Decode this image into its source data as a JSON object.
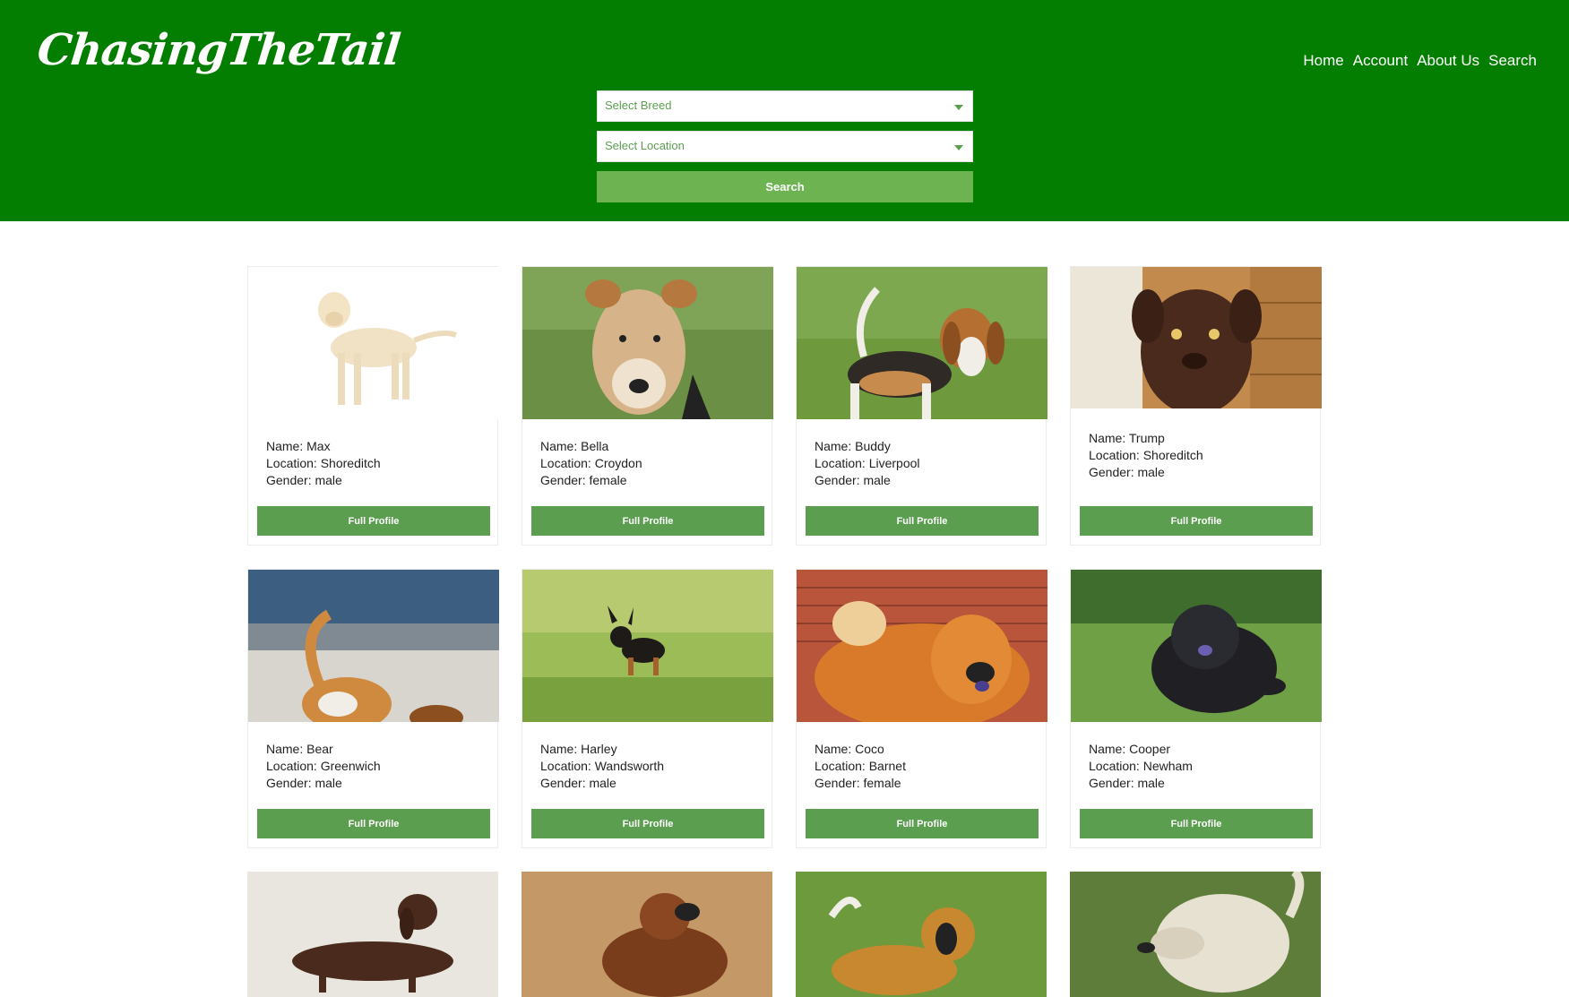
{
  "brand": {
    "logo": "ChasingTheTail"
  },
  "nav": [
    "Home",
    "Account",
    "About Us",
    "Search"
  ],
  "search": {
    "breed_placeholder": "Select Breed",
    "location_placeholder": "Select Location",
    "button": "Search"
  },
  "colors": {
    "header": "#037e00",
    "button": "#5b9e50",
    "search_button": "#6db352"
  },
  "dogs": [
    {
      "name": "Name: Max",
      "location": "Location: Shoreditch",
      "gender": "Gender: male",
      "button": "Full Profile"
    },
    {
      "name": "Name: Bella",
      "location": "Location: Croydon",
      "gender": "Gender: female",
      "button": "Full Profile"
    },
    {
      "name": "Name: Buddy",
      "location": "Location: Liverpool",
      "gender": "Gender: male",
      "button": "Full Profile"
    },
    {
      "name": "Name: Trump",
      "location": "Location: Shoreditch",
      "gender": "Gender: male",
      "button": "Full Profile"
    },
    {
      "name": "Name: Bear",
      "location": "Location: Greenwich",
      "gender": "Gender: male",
      "button": "Full Profile"
    },
    {
      "name": "Name: Harley",
      "location": "Location: Wandsworth",
      "gender": "Gender: male",
      "button": "Full Profile"
    },
    {
      "name": "Name: Coco",
      "location": "Location: Barnet",
      "gender": "Gender: female",
      "button": "Full Profile"
    },
    {
      "name": "Name: Cooper",
      "location": "Location: Newham",
      "gender": "Gender: male",
      "button": "Full Profile"
    }
  ]
}
